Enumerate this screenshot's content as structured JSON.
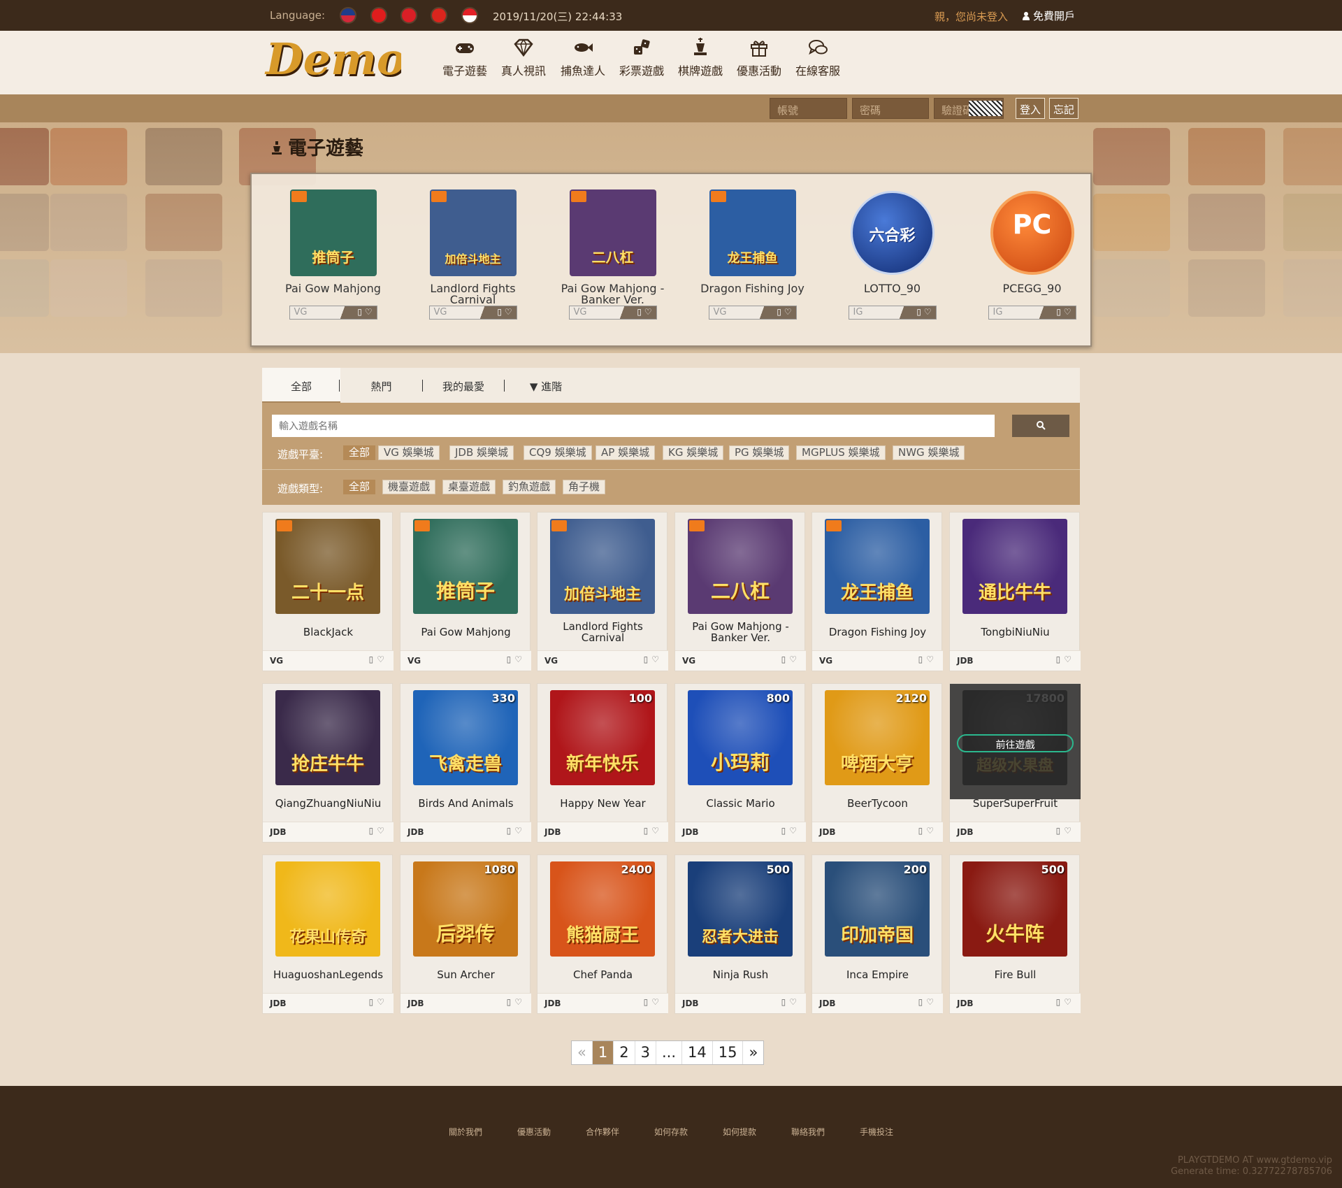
{
  "topbar": {
    "language_label": "Language:",
    "flags": [
      {
        "name": "us-flag",
        "top": "#1f3d8a",
        "bottom": "#d3283a"
      },
      {
        "name": "cn-flag",
        "top": "#e01d1d",
        "bottom": "#e01d1d"
      },
      {
        "name": "hk-flag",
        "top": "#d91f26",
        "bottom": "#d91f26"
      },
      {
        "name": "vn-flag",
        "top": "#da251d",
        "bottom": "#da251d"
      },
      {
        "name": "id-flag",
        "top": "#e32027",
        "bottom": "#ffffff"
      }
    ],
    "datetime": "2019/11/20(三) 22:44:33",
    "guest_text": "親，您尚未登入",
    "register_label": "免費開戶"
  },
  "nav": {
    "items": [
      {
        "label": "電子遊藝",
        "icon": "gamepad-icon"
      },
      {
        "label": "真人視訊",
        "icon": "diamond-icon"
      },
      {
        "label": "捕魚達人",
        "icon": "fish-icon"
      },
      {
        "label": "彩票遊戲",
        "icon": "dice-icon"
      },
      {
        "label": "棋牌遊戲",
        "icon": "chess-icon"
      },
      {
        "label": "優惠活動",
        "icon": "gift-icon"
      },
      {
        "label": "在線客服",
        "icon": "chat-icon"
      }
    ]
  },
  "login": {
    "account_placeholder": "帳號",
    "password_placeholder": "密碼",
    "captcha_placeholder": "驗證碼",
    "login_label": "登入",
    "forgot_label": "忘記"
  },
  "section_title": "電子遊藝",
  "featured": [
    {
      "name": "Pai Gow Mahjong",
      "platform": "VG",
      "thumb_text": "推筒子",
      "bg": "#2f6d5b"
    },
    {
      "name": "Landlord Fights Carnival",
      "platform": "VG",
      "thumb_text": "加倍斗地主",
      "bg": "#3f5d8f"
    },
    {
      "name": "Pai Gow Mahjong - Banker Ver.",
      "platform": "VG",
      "thumb_text": "二八杠",
      "bg": "#5a3a72"
    },
    {
      "name": "Dragon Fishing Joy",
      "platform": "VG",
      "thumb_text": "龙王捕鱼",
      "bg": "#2c5ea3"
    },
    {
      "name": "LOTTO_90",
      "platform": "IG",
      "thumb_text": "六合彩",
      "bg": "#1d3d8f"
    },
    {
      "name": "PCEGG_90",
      "platform": "IG",
      "thumb_text": "PC",
      "bg": "#e55a17"
    }
  ],
  "tabs": [
    "全部",
    "熱門",
    "我的最愛",
    "進階"
  ],
  "search": {
    "placeholder": "輸入遊戲名稱"
  },
  "filters": {
    "platform_label": "遊戲平臺:",
    "platforms": [
      "全部",
      "VG 娛樂城",
      "JDB 娛樂城",
      "CQ9 娛樂城",
      "AP 娛樂城",
      "KG 娛樂城",
      "PG 娛樂城",
      "MGPLUS 娛樂城",
      "NWG 娛樂城"
    ],
    "type_label": "遊戲類型:",
    "types": [
      "全部",
      "機臺遊戲",
      "桌臺遊戲",
      "釣魚遊戲",
      "角子機"
    ]
  },
  "games": [
    {
      "name": "BlackJack",
      "platform": "VG",
      "thumb_text": "二十一点",
      "num": "",
      "bg": "#7a5a2a",
      "badge": true
    },
    {
      "name": "Pai Gow Mahjong",
      "platform": "VG",
      "thumb_text": "推筒子",
      "num": "",
      "bg": "#2f6d5b",
      "badge": true
    },
    {
      "name": "Landlord Fights Carnival",
      "platform": "VG",
      "thumb_text": "加倍斗地主",
      "num": "",
      "bg": "#3f5d8f",
      "badge": true
    },
    {
      "name": "Pai Gow Mahjong - Banker Ver.",
      "platform": "VG",
      "thumb_text": "二八杠",
      "num": "",
      "bg": "#5a3a72",
      "badge": true
    },
    {
      "name": "Dragon Fishing Joy",
      "platform": "VG",
      "thumb_text": "龙王捕鱼",
      "num": "",
      "bg": "#2c5ea3",
      "badge": true
    },
    {
      "name": "TongbiNiuNiu",
      "platform": "JDB",
      "thumb_text": "通比牛牛",
      "num": "",
      "bg": "#4a2a7a",
      "badge": false
    },
    {
      "name": "QiangZhuangNiuNiu",
      "platform": "JDB",
      "thumb_text": "抢庄牛牛",
      "num": "",
      "bg": "#3a2a4a",
      "badge": false
    },
    {
      "name": "Birds And Animals",
      "platform": "JDB",
      "thumb_text": "飞禽走兽",
      "num": "330",
      "bg": "#1f64b8",
      "badge": false
    },
    {
      "name": "Happy New Year",
      "platform": "JDB",
      "thumb_text": "新年快乐",
      "num": "100",
      "bg": "#b0161a",
      "badge": false
    },
    {
      "name": "Classic Mario",
      "platform": "JDB",
      "thumb_text": "小玛莉",
      "num": "800",
      "bg": "#1e4fb8",
      "badge": false
    },
    {
      "name": "BeerTycoon",
      "platform": "JDB",
      "thumb_text": "啤酒大亨",
      "num": "2120",
      "bg": "#e09a17",
      "badge": false
    },
    {
      "name": "SuperSuperFruit",
      "platform": "JDB",
      "thumb_text": "超级水果盘",
      "num": "17800",
      "bg": "#3a3a3a",
      "badge": false,
      "hover": "前往遊戲"
    },
    {
      "name": "HuaguoshanLegends",
      "platform": "JDB",
      "thumb_text": "花果山传奇",
      "num": "",
      "bg": "#f0b81a",
      "badge": false
    },
    {
      "name": "Sun Archer",
      "platform": "JDB",
      "thumb_text": "后羿传",
      "num": "1080",
      "bg": "#c8781a",
      "badge": false
    },
    {
      "name": "Chef Panda",
      "platform": "JDB",
      "thumb_text": "熊猫厨王",
      "num": "2400",
      "bg": "#d8541a",
      "badge": false
    },
    {
      "name": "Ninja Rush",
      "platform": "JDB",
      "thumb_text": "忍者大进击",
      "num": "500",
      "bg": "#1a3f7a",
      "badge": false
    },
    {
      "name": "Inca Empire",
      "platform": "JDB",
      "thumb_text": "印加帝国",
      "num": "200",
      "bg": "#2a4f7a",
      "badge": false
    },
    {
      "name": "Fire Bull",
      "platform": "JDB",
      "thumb_text": "火牛阵",
      "num": "500",
      "bg": "#8a1a12",
      "badge": false
    }
  ],
  "pagination": [
    "«",
    "1",
    "2",
    "3",
    "...",
    "14",
    "15",
    "»"
  ],
  "footer": {
    "links": [
      "關於我們",
      "優惠活動",
      "合作夥伴",
      "如何存款",
      "如何提款",
      "聯絡我們",
      "手機投注"
    ],
    "copyright": "PLAYGTDEMO AT www.gtdemo.vip",
    "generate": "Generate time: 0.32772278785706"
  },
  "logo_text": "Demo",
  "colors": {
    "accent": "#a8855b",
    "dark": "#3c2a1b",
    "badge": "#f07b1c"
  }
}
